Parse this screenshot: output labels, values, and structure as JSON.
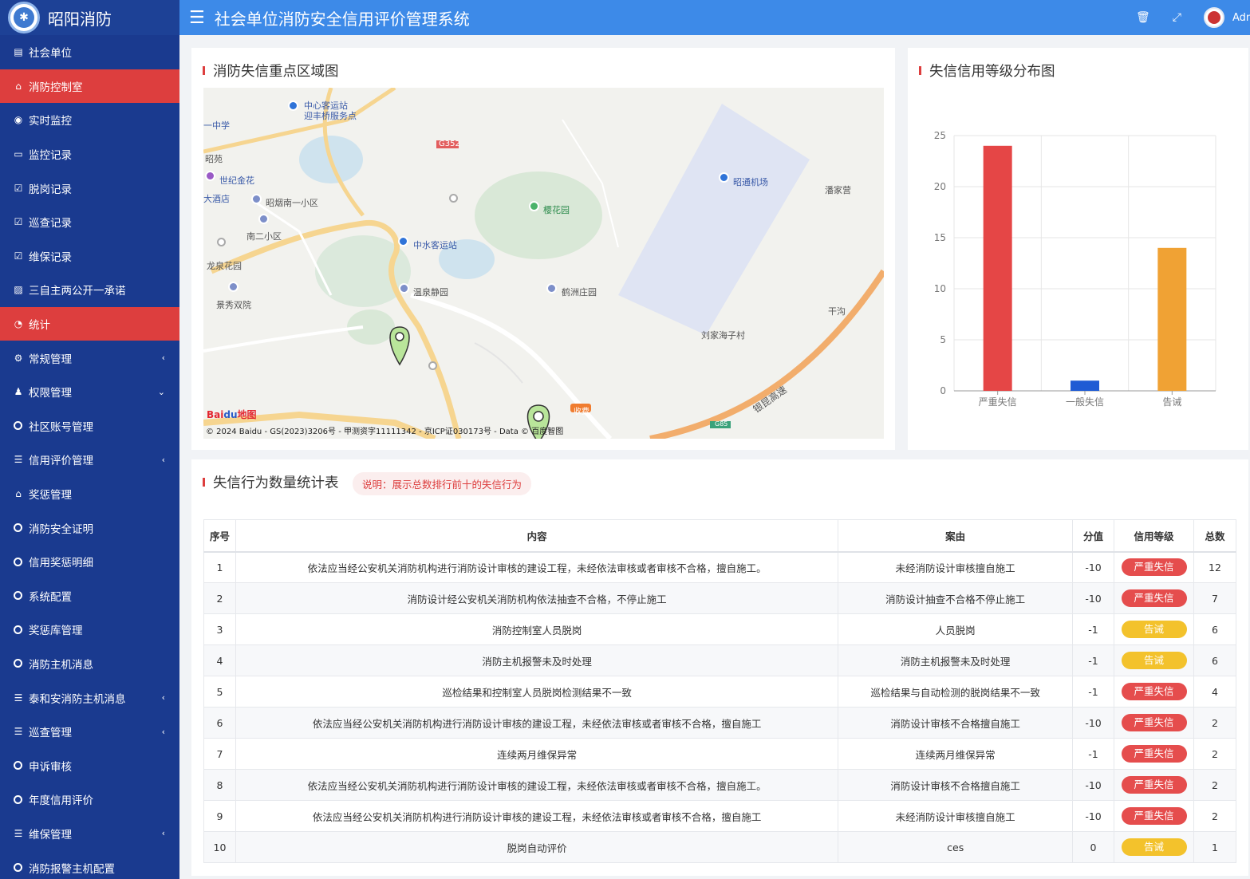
{
  "sidebar": {
    "brand": "昭阳消防",
    "items": [
      {
        "label": "社会单位",
        "icon": "building-icon",
        "glyph": "▤",
        "active": false,
        "arrow": ""
      },
      {
        "label": "消防控制室",
        "icon": "bank-icon",
        "glyph": "⌂",
        "active": true,
        "arrow": ""
      },
      {
        "label": "实时监控",
        "icon": "play-icon",
        "glyph": "◉",
        "active": false,
        "arrow": ""
      },
      {
        "label": "监控记录",
        "icon": "monitor-icon",
        "glyph": "▭",
        "active": false,
        "arrow": ""
      },
      {
        "label": "脱岗记录",
        "icon": "calendar-check-icon",
        "glyph": "☑",
        "active": false,
        "arrow": ""
      },
      {
        "label": "巡查记录",
        "icon": "calendar-check-icon",
        "glyph": "☑",
        "active": false,
        "arrow": ""
      },
      {
        "label": "维保记录",
        "icon": "calendar-check-icon",
        "glyph": "☑",
        "active": false,
        "arrow": ""
      },
      {
        "label": "三自主两公开一承诺",
        "icon": "image-icon",
        "glyph": "▨",
        "active": false,
        "arrow": ""
      },
      {
        "label": "统计",
        "icon": "dashboard-icon",
        "glyph": "◔",
        "active": true,
        "arrow": ""
      },
      {
        "label": "常规管理",
        "icon": "cogs-icon",
        "glyph": "⚙",
        "active": false,
        "arrow": "‹"
      },
      {
        "label": "权限管理",
        "icon": "group-icon",
        "glyph": "♟",
        "active": false,
        "arrow": "⌄"
      },
      {
        "label": "社区账号管理",
        "icon": "circle-icon",
        "glyph": "ring",
        "active": false,
        "arrow": ""
      },
      {
        "label": "信用评价管理",
        "icon": "list-icon",
        "glyph": "☰",
        "active": false,
        "arrow": "‹"
      },
      {
        "label": "奖惩管理",
        "icon": "bank-icon",
        "glyph": "⌂",
        "active": false,
        "arrow": ""
      },
      {
        "label": "消防安全证明",
        "icon": "circle-icon",
        "glyph": "ring",
        "active": false,
        "arrow": ""
      },
      {
        "label": "信用奖惩明细",
        "icon": "circle-icon",
        "glyph": "ring",
        "active": false,
        "arrow": ""
      },
      {
        "label": "系统配置",
        "icon": "circle-icon",
        "glyph": "ring",
        "active": false,
        "arrow": ""
      },
      {
        "label": "奖惩库管理",
        "icon": "circle-icon",
        "glyph": "ring",
        "active": false,
        "arrow": ""
      },
      {
        "label": "消防主机消息",
        "icon": "circle-icon",
        "glyph": "ring",
        "active": false,
        "arrow": ""
      },
      {
        "label": "泰和安消防主机消息",
        "icon": "list-icon",
        "glyph": "☰",
        "active": false,
        "arrow": "‹"
      },
      {
        "label": "巡查管理",
        "icon": "list-icon",
        "glyph": "☰",
        "active": false,
        "arrow": "‹"
      },
      {
        "label": "申诉审核",
        "icon": "circle-icon",
        "glyph": "ring",
        "active": false,
        "arrow": ""
      },
      {
        "label": "年度信用评价",
        "icon": "circle-icon",
        "glyph": "ring",
        "active": false,
        "arrow": ""
      },
      {
        "label": "维保管理",
        "icon": "list-icon",
        "glyph": "☰",
        "active": false,
        "arrow": "‹"
      },
      {
        "label": "消防报警主机配置",
        "icon": "circle-icon",
        "glyph": "ring",
        "active": false,
        "arrow": ""
      }
    ]
  },
  "header": {
    "title": "社会单位消防安全信用评价管理系统",
    "user": "Admin"
  },
  "map_panel": {
    "title": "消防失信重点区域图",
    "copyright": "© 2024 Baidu - GS(2023)3206号 - 甲测资字11111342 - 京ICP证030173号 - Data © 百度智图",
    "logo_a": "Bai",
    "logo_b": "du",
    "logo_c": "地图",
    "labels": [
      {
        "text": "中心客运站",
        "cls": "blue"
      },
      {
        "text": "迎丰桥服务点",
        "cls": "blue"
      },
      {
        "text": "一中学",
        "cls": "blue"
      },
      {
        "text": "G352",
        "cls": "road"
      },
      {
        "text": "昭苑",
        "cls": ""
      },
      {
        "text": "世纪金花",
        "cls": "blue"
      },
      {
        "text": "大酒店",
        "cls": "blue"
      },
      {
        "text": "昭烟南一小区",
        "cls": ""
      },
      {
        "text": "樱花园",
        "cls": "green"
      },
      {
        "text": "昭通机场",
        "cls": "blue"
      },
      {
        "text": "潘家营",
        "cls": ""
      },
      {
        "text": "南二小区",
        "cls": ""
      },
      {
        "text": "中水客运站",
        "cls": "blue"
      },
      {
        "text": "龙泉花园",
        "cls": ""
      },
      {
        "text": "温泉静园",
        "cls": ""
      },
      {
        "text": "鹤洲庄园",
        "cls": ""
      },
      {
        "text": "景秀双院",
        "cls": ""
      },
      {
        "text": "干沟",
        "cls": ""
      },
      {
        "text": "刘家海子村",
        "cls": ""
      },
      {
        "text": "银昆高速",
        "cls": ""
      },
      {
        "text": "收费",
        "cls": "road"
      },
      {
        "text": "G85",
        "cls": "road"
      }
    ]
  },
  "chart_panel": {
    "title": "失信信用等级分布图"
  },
  "chart_data": {
    "type": "bar",
    "categories": [
      "严重失信",
      "一般失信",
      "告诫"
    ],
    "values": [
      24,
      1,
      14
    ],
    "colors": [
      "#e54646",
      "#1f5bd4",
      "#f0a234"
    ],
    "ylim": [
      0,
      25
    ],
    "yticks": [
      "0",
      "5",
      "10",
      "15",
      "20",
      "25"
    ],
    "grid": true
  },
  "table_panel": {
    "title": "失信行为数量统计表",
    "note": "说明：展示总数排行前十的失信行为",
    "columns": [
      "序号",
      "内容",
      "案由",
      "分值",
      "信用等级",
      "总数"
    ],
    "rows": [
      {
        "no": "1",
        "content": "依法应当经公安机关消防机构进行消防设计审核的建设工程，未经依法审核或者审核不合格，擅自施工。",
        "cause": "未经消防设计审核擅自施工",
        "score": "-10",
        "level": "严重失信",
        "level_type": "severe",
        "total": "12"
      },
      {
        "no": "2",
        "content": "消防设计经公安机关消防机构依法抽查不合格，不停止施工",
        "cause": "消防设计抽查不合格不停止施工",
        "score": "-10",
        "level": "严重失信",
        "level_type": "severe",
        "total": "7"
      },
      {
        "no": "3",
        "content": "消防控制室人员脱岗",
        "cause": "人员脱岗",
        "score": "-1",
        "level": "告诫",
        "level_type": "warn",
        "total": "6"
      },
      {
        "no": "4",
        "content": "消防主机报警未及时处理",
        "cause": "消防主机报警未及时处理",
        "score": "-1",
        "level": "告诫",
        "level_type": "warn",
        "total": "6"
      },
      {
        "no": "5",
        "content": "巡检结果和控制室人员脱岗检测结果不一致",
        "cause": "巡检结果与自动检测的脱岗结果不一致",
        "score": "-1",
        "level": "严重失信",
        "level_type": "severe",
        "total": "4"
      },
      {
        "no": "6",
        "content": "依法应当经公安机关消防机构进行消防设计审核的建设工程，未经依法审核或者审核不合格，擅自施工",
        "cause": "消防设计审核不合格擅自施工",
        "score": "-10",
        "level": "严重失信",
        "level_type": "severe",
        "total": "2"
      },
      {
        "no": "7",
        "content": "连续两月维保异常",
        "cause": "连续两月维保异常",
        "score": "-1",
        "level": "严重失信",
        "level_type": "severe",
        "total": "2"
      },
      {
        "no": "8",
        "content": "依法应当经公安机关消防机构进行消防设计审核的建设工程，未经依法审核或者审核不合格，擅自施工。",
        "cause": "消防设计审核不合格擅自施工",
        "score": "-10",
        "level": "严重失信",
        "level_type": "severe",
        "total": "2"
      },
      {
        "no": "9",
        "content": "依法应当经公安机关消防机构进行消防设计审核的建设工程，未经依法审核或者审核不合格，擅自施工",
        "cause": "未经消防设计审核擅自施工",
        "score": "-10",
        "level": "严重失信",
        "level_type": "severe",
        "total": "2"
      },
      {
        "no": "10",
        "content": "脱岗自动评价",
        "cause": "ces",
        "score": "0",
        "level": "告诫",
        "level_type": "warn",
        "total": "1"
      }
    ]
  }
}
